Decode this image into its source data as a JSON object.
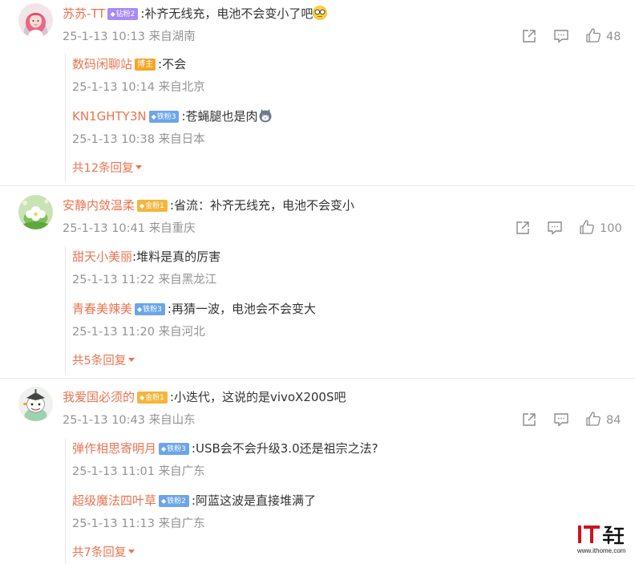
{
  "threads": [
    {
      "author": "苏苏-TT",
      "badge": "钻粉2",
      "text": ":补齐无线充，电池不会变小了吧",
      "emoji": "glasses-emoji",
      "time": "25-1-13 10:13 来自湖南",
      "likes": "48",
      "replies": [
        {
          "author": "数码闲聊站",
          "badge": "博主",
          "text": ":不会",
          "time": "25-1-13 10:14 来自北京"
        },
        {
          "author": "KN1GHTY3N",
          "badge": "铁粉3",
          "text": ":苍蝇腿也是肉",
          "emoji": "cat-emoji",
          "time": "25-1-13 10:38 来自日本"
        }
      ],
      "more": "共12条回复"
    },
    {
      "author": "安静内敛温柔",
      "badge": "金粉1",
      "text": ":省流：补齐无线充，电池不会变小",
      "time": "25-1-13 10:41 来自重庆",
      "likes": "100",
      "replies": [
        {
          "author": "甜天小美丽",
          "text": ":堆料是真的厉害",
          "time": "25-1-13 11:22 来自黑龙江"
        },
        {
          "author": "青春美辣美",
          "badge": "铁粉3",
          "text": ":再猜一波，电池会不会变大",
          "time": "25-1-13 11:20 来自河北"
        }
      ],
      "more": "共5条回复"
    },
    {
      "author": "我爱国必须的",
      "badge": "金粉1",
      "text": ":小迭代，这说的是vivoX200S吧",
      "time": "25-1-13 10:43 来自山东",
      "likes": "84",
      "replies": [
        {
          "author": "弹作相思寄明月",
          "badge": "铁粉3",
          "text": ":USB会不会升级3.0还是祖宗之法?",
          "time": "25-1-13 11:01 来自广东"
        },
        {
          "author": "超级魔法四叶草",
          "badge": "铁粉2",
          "text": ":阿蓝这波是直接堆满了",
          "time": "25-1-13 11:13 来自广东"
        }
      ],
      "more": "共7条回复"
    }
  ],
  "watermark": {
    "brand": "IT之家",
    "url": "www.ithome.com"
  },
  "colors": {
    "username": "#eb7350",
    "meta": "#939393",
    "text": "#333333"
  }
}
